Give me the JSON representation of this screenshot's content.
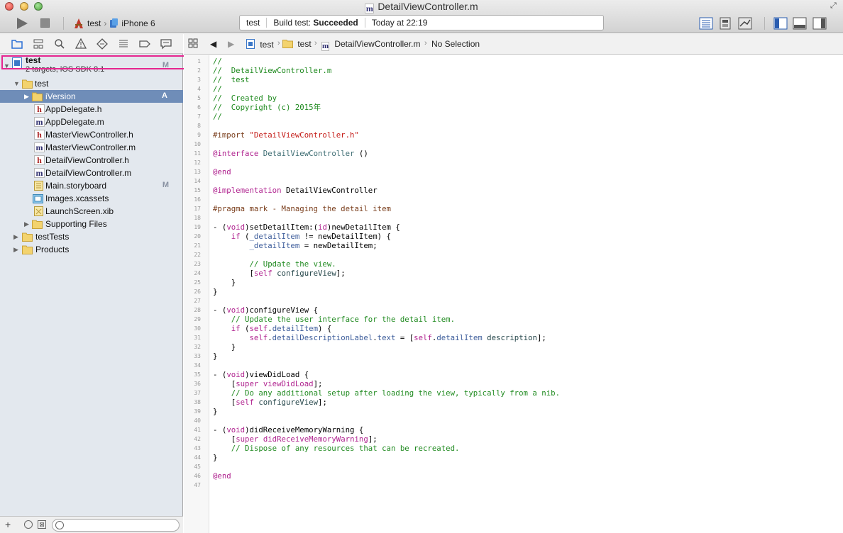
{
  "window": {
    "title": "DetailViewController.m",
    "file_badge": "m"
  },
  "toolbar": {
    "scheme_target": "test",
    "scheme_device": "iPhone 6",
    "activity": {
      "project": "test",
      "status_prefix": "Build test: ",
      "status_result": "Succeeded",
      "time": "Today at 22:19"
    }
  },
  "navigator": {
    "project": {
      "name": "test",
      "subtitle": "2 targets, iOS SDK 8.1",
      "badge": "M"
    },
    "items": [
      {
        "label": "test",
        "kind": "folder",
        "expanded": true,
        "badge": ""
      },
      {
        "label": "iVersion",
        "kind": "folder",
        "expanded": false,
        "badge": "A",
        "selected": true
      },
      {
        "label": "AppDelegate.h",
        "kind": "h",
        "badge": ""
      },
      {
        "label": "AppDelegate.m",
        "kind": "m",
        "badge": ""
      },
      {
        "label": "MasterViewController.h",
        "kind": "h",
        "badge": ""
      },
      {
        "label": "MasterViewController.m",
        "kind": "m",
        "badge": ""
      },
      {
        "label": "DetailViewController.h",
        "kind": "h",
        "badge": ""
      },
      {
        "label": "DetailViewController.m",
        "kind": "m",
        "badge": ""
      },
      {
        "label": "Main.storyboard",
        "kind": "storyboard",
        "badge": "M"
      },
      {
        "label": "Images.xcassets",
        "kind": "xcassets",
        "badge": ""
      },
      {
        "label": "LaunchScreen.xib",
        "kind": "xib",
        "badge": ""
      },
      {
        "label": "Supporting Files",
        "kind": "folder",
        "expanded": false,
        "badge": ""
      },
      {
        "label": "testTests",
        "kind": "folder",
        "expanded": false,
        "badge": ""
      },
      {
        "label": "Products",
        "kind": "folder",
        "expanded": false,
        "badge": ""
      }
    ]
  },
  "jumpbar": {
    "project": "test",
    "group": "test",
    "file": "DetailViewController.m",
    "selection": "No Selection"
  },
  "editor": {
    "lines": [
      "//",
      "//  DetailViewController.m",
      "//  test",
      "//",
      "//  Created by",
      "//  Copyright (c) 2015年",
      "//",
      "",
      "#import \"DetailViewController.h\"",
      "",
      "@interface DetailViewController ()",
      "",
      "@end",
      "",
      "@implementation DetailViewController",
      "",
      "#pragma mark - Managing the detail item",
      "",
      "- (void)setDetailItem:(id)newDetailItem {",
      "    if (_detailItem != newDetailItem) {",
      "        _detailItem = newDetailItem;",
      "",
      "        // Update the view.",
      "        [self configureView];",
      "    }",
      "}",
      "",
      "- (void)configureView {",
      "    // Update the user interface for the detail item.",
      "    if (self.detailItem) {",
      "        self.detailDescriptionLabel.text = [self.detailItem description];",
      "    }",
      "}",
      "",
      "- (void)viewDidLoad {",
      "    [super viewDidLoad];",
      "    // Do any additional setup after loading the view, typically from a nib.",
      "    [self configureView];",
      "}",
      "",
      "- (void)didReceiveMemoryWarning {",
      "    [super didReceiveMemoryWarning];",
      "    // Dispose of any resources that can be recreated.",
      "}",
      "",
      "@end",
      ""
    ]
  },
  "colors": {
    "comment": "#1f8a1f",
    "keyword": "#b0238f",
    "string": "#c41a16",
    "selection": "#6f8db8",
    "highlight_box": "#e6258f"
  }
}
